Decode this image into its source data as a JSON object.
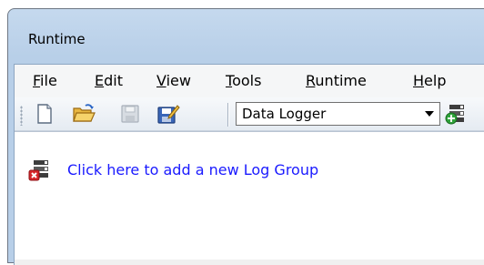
{
  "window": {
    "title": "Runtime"
  },
  "menu": {
    "file": {
      "label": "File",
      "underline": "F",
      "rest": "ile"
    },
    "edit": {
      "label": "Edit",
      "underline": "E",
      "rest": "dit"
    },
    "view": {
      "label": "View",
      "underline": "V",
      "rest": "iew"
    },
    "tools": {
      "label": "Tools",
      "underline": "T",
      "rest": "ools"
    },
    "runtime": {
      "label": "Runtime",
      "underline": "R",
      "rest": "untime"
    },
    "help": {
      "label": "Help",
      "underline": "H",
      "rest": "elp"
    }
  },
  "toolbar": {
    "buttons": [
      "new-document-icon",
      "open-folder-icon",
      "save-icon",
      "save-as-icon"
    ],
    "selector_value": "Data Logger",
    "add_button_icon": "add-log-group-icon"
  },
  "content": {
    "add_log_group_text": "Click here to add a new Log Group",
    "add_log_group_icon": "log-group-error-icon"
  },
  "colors": {
    "link": "#1a1aff",
    "title_bar": "#c5d9ee"
  }
}
